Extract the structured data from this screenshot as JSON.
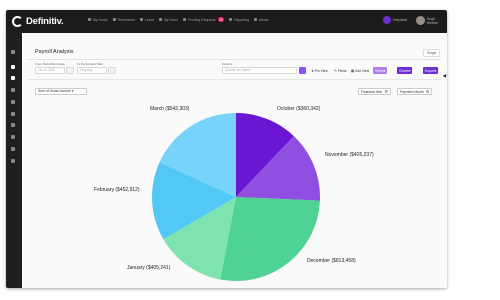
{
  "app": {
    "logo_text": "Definitiv."
  },
  "nav": [
    {
      "label": "My Home",
      "icon": "home-icon"
    },
    {
      "label": "Timesheets",
      "icon": "timesheet-icon"
    },
    {
      "label": "Leave",
      "icon": "leave-icon"
    },
    {
      "label": "My Team",
      "icon": "team-icon"
    },
    {
      "label": "Pending Requests",
      "icon": "pending-icon",
      "badge": "25"
    },
    {
      "label": "Reporting",
      "icon": "reporting-icon"
    },
    {
      "label": "Admin",
      "icon": "admin-icon"
    }
  ],
  "org": {
    "label": "Helpdesk"
  },
  "user": {
    "label": "Hugh Webber"
  },
  "page": {
    "title": "Payroll Analysis",
    "single_label": "Single"
  },
  "filters": {
    "from_label": "From Period End Date",
    "to_label": "To Period End Date",
    "from_placeholder": "1st Jul 2020",
    "to_placeholder": "Ongoing",
    "options_label": "Options",
    "options_placeholder": "Choose an Option"
  },
  "toolbar": {
    "pin_label": "Pin View",
    "fields_label": "Fields",
    "add_view_label": "Add View",
    "views_label": "Views",
    "charts_label": "Charts",
    "export_label": "Export"
  },
  "chart_controls": {
    "metric": "Sum of Gross Income",
    "group1": "Financial Year",
    "group2": "Payment Month"
  },
  "colors": {
    "purple": "#8c52ff",
    "dark_purple": "#6a2fd1",
    "topbar": "#1c1c1c"
  },
  "chart_data": {
    "type": "pie",
    "slices": [
      {
        "label": "October ($360,342)",
        "value": 360342,
        "color": "#6b16d2"
      },
      {
        "label": "November ($405,237)",
        "value": 405237,
        "color": "#8f4fe0"
      },
      {
        "label": "December ($813,458)",
        "value": 813458,
        "color": "#4ed394"
      },
      {
        "label": "January ($405,241)",
        "value": 405241,
        "color": "#7fe3b0"
      },
      {
        "label": "February ($452,912)",
        "value": 452912,
        "color": "#54c8f5"
      },
      {
        "label": "March ($542,303)",
        "value": 542303,
        "color": "#78d3fb"
      }
    ]
  }
}
